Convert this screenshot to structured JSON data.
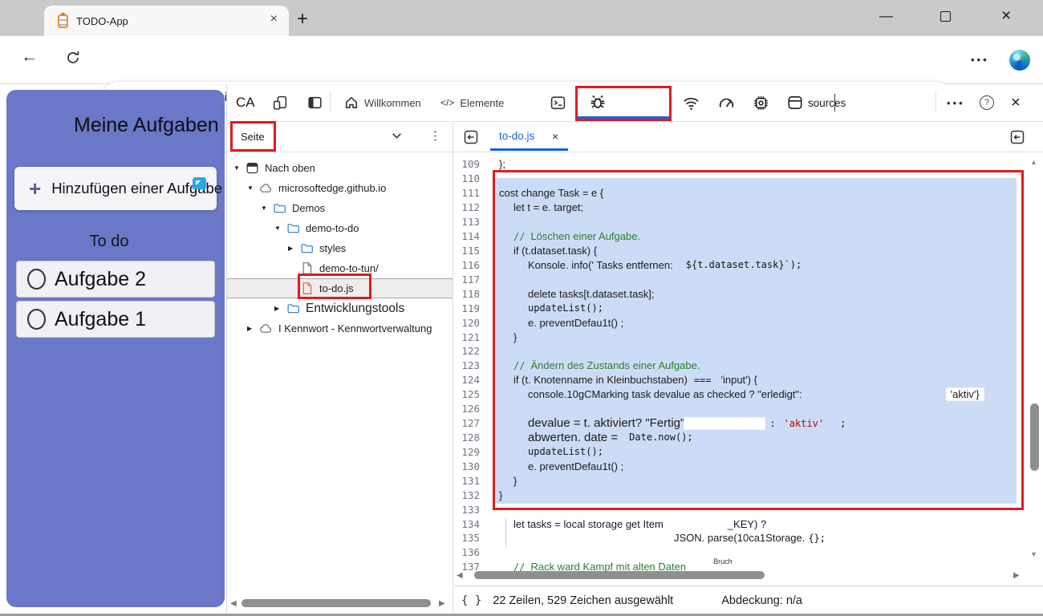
{
  "colors": {
    "annotation_red": "#e01b1d",
    "selection_blue": "#cddcf6",
    "active_blue": "#1766d9",
    "page_purple": "#6b77c7",
    "comment_green": "#2e7d32",
    "string_red": "#c00000"
  },
  "browser": {
    "tab_title": "TODO-App",
    "url_host": "microsoftedge.github.io",
    "url_path": "/Demos/demo-to-do/"
  },
  "page": {
    "title": "Meine Aufgaben",
    "add_button_label": "Hinzufügen einer Aufgabe",
    "list_heading": "To do",
    "tasks": [
      "Aufgabe 2",
      "Aufgabe 1"
    ]
  },
  "devtools": {
    "toolbar": {
      "inspect_label": "CA",
      "tab_welcome": "Willkommen",
      "elements_glyph": "</>",
      "tab_elements": "Elemente",
      "sources_label": "sources"
    },
    "navigator": {
      "panel_label": "Seite",
      "tree": [
        {
          "label": "Nach oben",
          "lvl": 0,
          "arrow": "open",
          "icon": "window"
        },
        {
          "label": "microsoftedge.github.io",
          "lvl": 1,
          "arrow": "open",
          "icon": "cloud"
        },
        {
          "label": "Demos",
          "lvl": 2,
          "arrow": "open",
          "icon": "folder"
        },
        {
          "label": "demo-to-do",
          "lvl": 3,
          "arrow": "open",
          "icon": "folder"
        },
        {
          "label": "styles",
          "lvl": 4,
          "arrow": "closed",
          "icon": "folder"
        },
        {
          "label": "demo-to-tun/",
          "lvl": 4,
          "arrow": "none",
          "icon": "file"
        },
        {
          "label": "to-do.js",
          "lvl": 4,
          "arrow": "none",
          "icon": "file-orange",
          "selected": true
        },
        {
          "label": "Entwicklungstools",
          "lvl": 3,
          "arrow": "closed",
          "icon": "folder",
          "size": 15.5
        },
        {
          "label": "I Kennwort - Kennwortverwaltung",
          "lvl": 1,
          "arrow": "closed",
          "icon": "cloud"
        }
      ]
    },
    "editor": {
      "tab": "to-do.js",
      "lines": [
        {
          "n": 109,
          "ind": 12,
          "seg": [
            {
              "t": "};",
              "c": "s"
            }
          ]
        },
        {
          "n": 110,
          "ind": 12,
          "seg": []
        },
        {
          "n": 111,
          "ind": 12,
          "seg": [
            {
              "t": "cost change Task = e {",
              "c": "s"
            }
          ]
        },
        {
          "n": 112,
          "ind": 30,
          "seg": [
            {
              "t": "let t = e. target;",
              "c": "s"
            }
          ]
        },
        {
          "n": 113,
          "ind": 12,
          "seg": []
        },
        {
          "n": 114,
          "ind": 30,
          "seg": [
            {
              "t": "//",
              "c": "m cg"
            },
            {
              "t": "Löschen einer Aufgabe.",
              "c": "s cg",
              "g": 7
            }
          ]
        },
        {
          "n": 115,
          "ind": 30,
          "seg": [
            {
              "t": "if (t.dataset.task) {",
              "c": "s"
            }
          ]
        },
        {
          "n": 116,
          "ind": 48,
          "seg": [
            {
              "t": "Konsole. info(' Tasks entfernen:",
              "c": "s"
            },
            {
              "t": "${t.dataset.task}`);",
              "c": "m",
              "g": 16
            }
          ]
        },
        {
          "n": 117,
          "ind": 12,
          "seg": []
        },
        {
          "n": 118,
          "ind": 48,
          "seg": [
            {
              "t": "delete tasks[t.dataset.task];",
              "c": "s"
            }
          ]
        },
        {
          "n": 119,
          "ind": 48,
          "seg": [
            {
              "t": "updateList();",
              "c": "m"
            }
          ]
        },
        {
          "n": 120,
          "ind": 48,
          "seg": [
            {
              "t": "e. preventDefau1t() ;",
              "c": "s"
            }
          ]
        },
        {
          "n": 121,
          "ind": 30,
          "seg": [
            {
              "t": "}",
              "c": "s"
            }
          ]
        },
        {
          "n": 122,
          "ind": 12,
          "seg": []
        },
        {
          "n": 123,
          "ind": 30,
          "seg": [
            {
              "t": "//",
              "c": "m cg"
            },
            {
              "t": "Ändern des Zustands einer Aufgabe.",
              "c": "s cg",
              "g": 7
            }
          ]
        },
        {
          "n": 124,
          "ind": 30,
          "seg": [
            {
              "t": "if (t. Knotenname in Kleinbuchstaben)",
              "c": "s"
            },
            {
              "t": "===",
              "c": "m",
              "g": 8
            },
            {
              "t": "'input') {",
              "c": "s",
              "g": 12
            }
          ]
        },
        {
          "n": 125,
          "ind": 48,
          "seg": [
            {
              "t": "console.10gCMarking task devalue as checked ? \"erledigt\":",
              "c": "s"
            },
            {
              "t": "'aktiv'}",
              "c": "s chip",
              "g": 180
            }
          ]
        },
        {
          "n": 126,
          "ind": 12,
          "seg": []
        },
        {
          "n": 127,
          "ind": 48,
          "seg": [
            {
              "t": "devalue = t. aktiviert? \"Fertig\"",
              "c": "s big"
            },
            {
              "t": "",
              "c": "pad chip",
              "w": 90
            },
            {
              "t": ":",
              "c": "m",
              "g": 6
            },
            {
              "t": "'aktiv'",
              "c": "m sr",
              "g": 10
            },
            {
              "t": ";",
              "c": "m",
              "g": 20
            }
          ]
        },
        {
          "n": 128,
          "ind": 48,
          "seg": [
            {
              "t": "abwerten. date =",
              "c": "s big"
            },
            {
              "t": "Date.now();",
              "c": "m",
              "g": 14
            }
          ]
        },
        {
          "n": 129,
          "ind": 48,
          "seg": [
            {
              "t": "updateList();",
              "c": "m"
            }
          ]
        },
        {
          "n": 130,
          "ind": 48,
          "seg": [
            {
              "t": "e. preventDefau1t() ;",
              "c": "s"
            }
          ]
        },
        {
          "n": 131,
          "ind": 30,
          "seg": [
            {
              "t": "}",
              "c": "s"
            }
          ]
        },
        {
          "n": 132,
          "ind": 12,
          "seg": [
            {
              "t": "}",
              "c": "s"
            }
          ]
        },
        {
          "n": 133,
          "ind": 12,
          "seg": []
        },
        {
          "n": 134,
          "ind": 30,
          "seg": [
            {
              "t": "let tasks = local storage get Item",
              "c": "s"
            },
            {
              "t": "_KEY) ?",
              "c": "s",
              "g": 80
            }
          ]
        },
        {
          "n": 135,
          "ind": 30,
          "seg": [
            {
              "t": "JSON. parse(10ca1Storage.",
              "c": "s",
              "g": 200
            },
            {
              "t": "{};",
              "c": "m",
              "g": 4
            }
          ]
        },
        {
          "n": 136,
          "ind": 12,
          "seg": []
        },
        {
          "n": 137,
          "ind": 30,
          "seg": [
            {
              "t": "//",
              "c": "m cg"
            },
            {
              "t": "Rack ward Kampf mit alten Daten",
              "c": "s cg",
              "g": 7
            },
            {
              "t": "Bruch",
              "c": "tiny",
              "g": 34
            }
          ]
        }
      ]
    },
    "statusbar": {
      "braces": "{ }",
      "selection": "22 Zeilen, 529 Zeichen ausgewählt",
      "coverage": "Abdeckung: n/a"
    }
  }
}
